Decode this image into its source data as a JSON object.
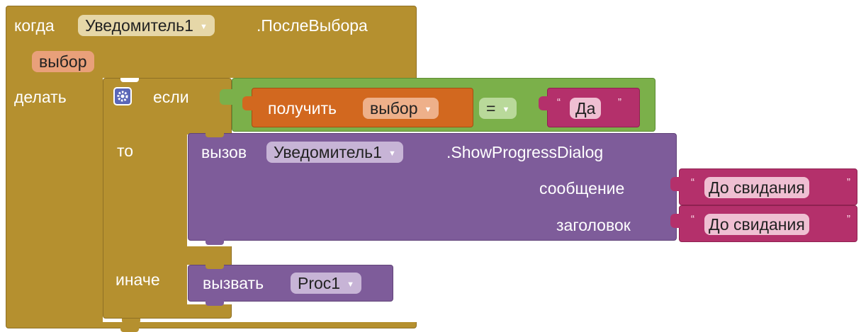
{
  "event": {
    "keyword": "когда",
    "component": "Уведомитель1",
    "event_name": ".ПослеВыбора",
    "param": "выбор",
    "do_label": "делать"
  },
  "if_block": {
    "if_label": "если",
    "then_label": "то",
    "else_label": "иначе"
  },
  "condition": {
    "get_label": "получить",
    "get_var": "выбор",
    "operator": "=",
    "text_value": "Да"
  },
  "call_block": {
    "keyword": "вызов",
    "component": "Уведомитель1",
    "method": ".ShowProgressDialog",
    "arg1_label": "сообщение",
    "arg1_value": "До свидания",
    "arg2_label": "заголовок",
    "arg2_value": "До свидания"
  },
  "else_call": {
    "keyword": "вызвать",
    "procedure": "Proc1"
  },
  "colors": {
    "event": "#b5902f",
    "control": "#b5902f",
    "logic": "#7bb04a",
    "variable": "#d2681f",
    "text": "#b4306b",
    "component": "#7e5c9a"
  },
  "icons": {
    "dropdown": "▼",
    "mutator": "gear-icon",
    "quote_open": "“",
    "quote_close": "”"
  }
}
